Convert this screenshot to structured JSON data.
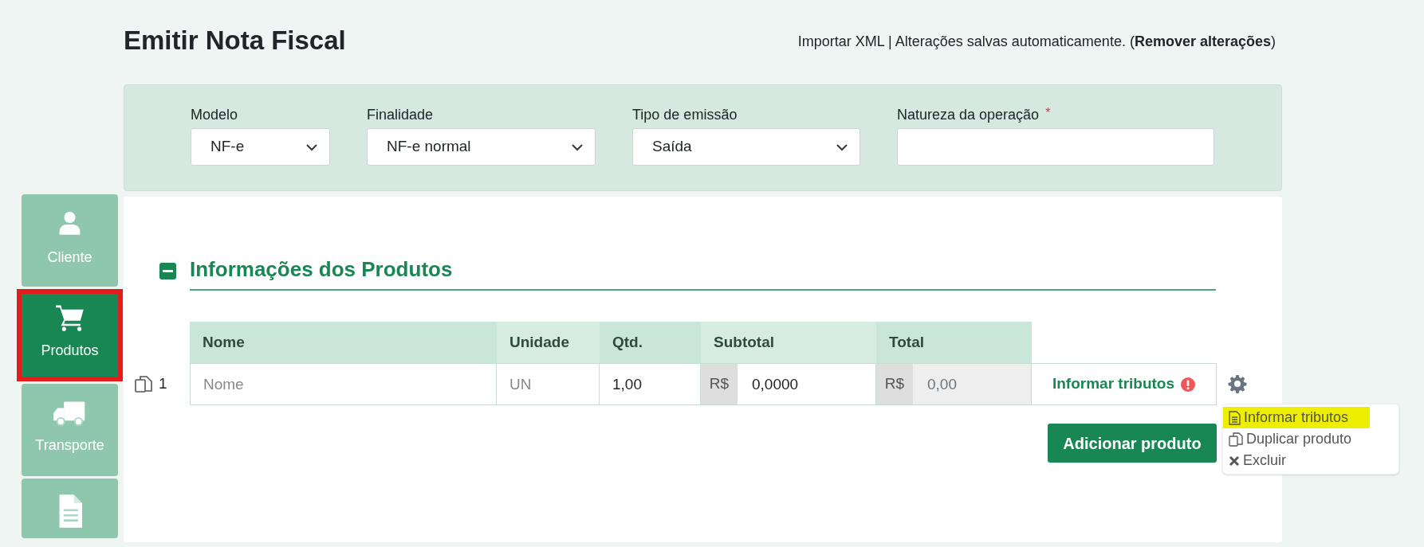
{
  "header": {
    "title": "Emitir Nota Fiscal",
    "info": "Importar XML | Alterações salvas automaticamente. (**Remover alterações**)"
  },
  "form": {
    "fields": [
      {
        "kind": "select",
        "label": "Modelo",
        "value": "NF-e"
      },
      {
        "kind": "select",
        "label": "Finalidade",
        "value": "NF-e normal"
      },
      {
        "kind": "select",
        "label": "Tipo de emissão",
        "value": "Saída"
      },
      {
        "kind": "text",
        "label": "Natureza da operação",
        "required_marker": "*"
      }
    ]
  },
  "sidebar": {
    "items": [
      {
        "kind": "user",
        "label": "Cliente",
        "selected": false,
        "highlighted": false
      },
      {
        "kind": "cart",
        "label": "Produtos",
        "selected": true,
        "highlighted": true
      },
      {
        "kind": "truck",
        "label": "Transporte",
        "selected": false,
        "highlighted": false
      },
      {
        "kind": "document",
        "selected": false,
        "highlighted": false
      }
    ]
  },
  "section": {
    "title": "Informações dos Produtos",
    "expanded": true
  },
  "table": {
    "columns": [
      "Nome",
      "Unidade",
      "Qtd.",
      "Subtotal",
      "Total"
    ],
    "rows": [
      {
        "index": "1",
        "cells": [
          {
            "placeholder": "Nome"
          },
          {
            "placeholder": "UN"
          },
          {
            "value": "1,00"
          },
          {
            "prefix": "R$",
            "value": "0,0000",
            "disabled": false
          },
          {
            "prefix": "R$",
            "value": "0,00",
            "disabled": true
          }
        ],
        "tax_button": "Informar tributos",
        "tax_pending": true
      }
    ]
  },
  "menu": {
    "items": [
      {
        "kind": "document",
        "label": "Informar tributos",
        "highlighted": true
      },
      {
        "kind": "copy",
        "label": "Duplicar produto",
        "highlighted": false
      },
      {
        "kind": "delete",
        "label": "Excluir",
        "highlighted": false
      }
    ]
  },
  "add_button": "Adicionar produto"
}
